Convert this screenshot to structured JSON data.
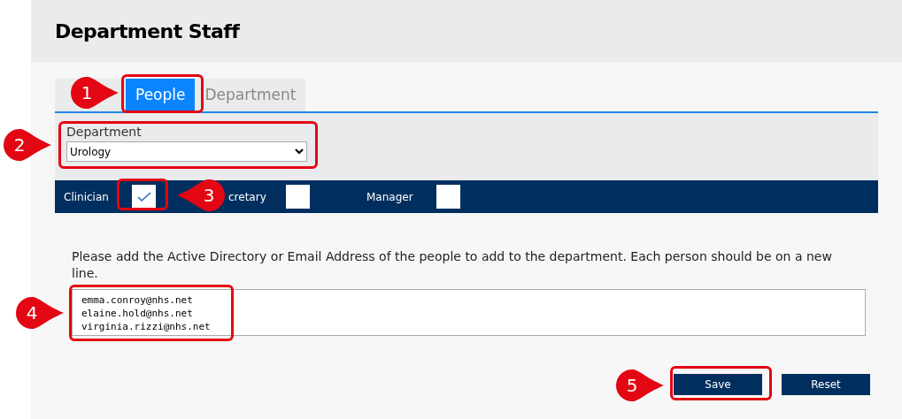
{
  "title": "Department Staff",
  "tabs": [
    {
      "selected": false
    },
    {
      "label": "People",
      "selected": true
    },
    {
      "label": "Department",
      "selected": false
    }
  ],
  "department": {
    "label": "Department",
    "value": "Urology"
  },
  "roles": [
    {
      "label": "Clinician",
      "checked": true
    },
    {
      "label": "cretary",
      "checked": false
    },
    {
      "label": "Manager",
      "checked": false
    }
  ],
  "instructions": "Please add the Active Directory or Email Address of the people to add to the department. Each person should be on a new line.",
  "emails": "emma.conroy@nhs.net\nelaine.hold@nhs.net\nvirginia.rizzi@nhs.net",
  "buttons": [
    "Save",
    "Reset"
  ],
  "callouts": [
    {
      "number": "1"
    },
    {
      "number": "2"
    },
    {
      "number": "3"
    },
    {
      "number": "4"
    },
    {
      "number": "5"
    }
  ]
}
